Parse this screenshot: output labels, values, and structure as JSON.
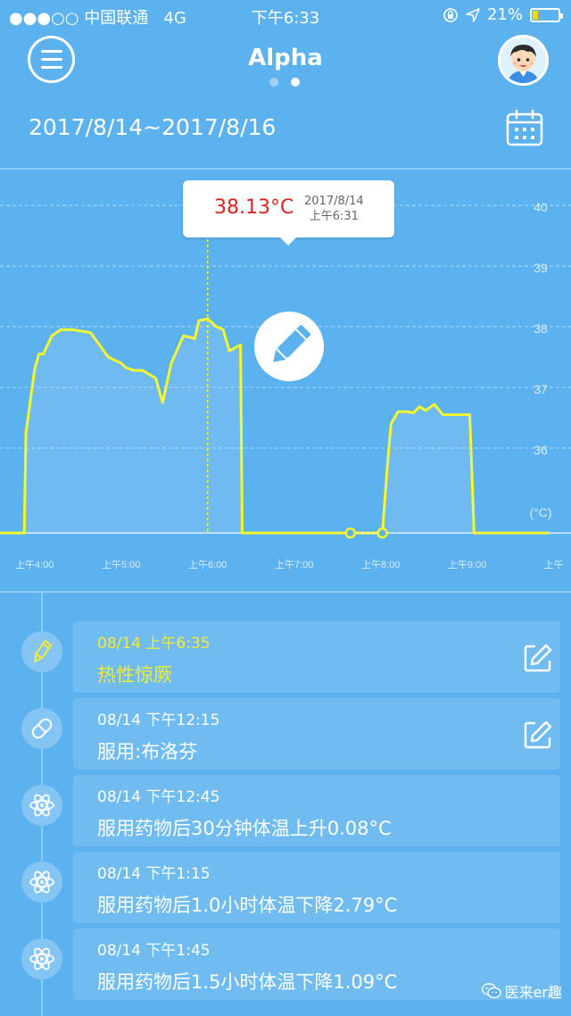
{
  "status_bar": {
    "signal": "●●●○○",
    "carrier": "中国联通",
    "network": "4G",
    "time": "下午6:33",
    "battery": "21%",
    "battery_level": 0.21
  },
  "header": {
    "title": "Alpha",
    "pages": 2,
    "active_page": 2
  },
  "date_range": "2017/8/14~2017/8/16",
  "tooltip": {
    "temperature": "38.13°C",
    "date": "2017/8/14",
    "time": "上午6:31"
  },
  "chart_data": {
    "type": "line",
    "y_unit_label": "(°C)",
    "y_ticks": [
      "36",
      "37",
      "38",
      "39",
      "40"
    ],
    "x_ticks": [
      "上午4:00",
      "上午5:00",
      "上午6:00",
      "上午7:00",
      "上午8:00",
      "上午9:00",
      "上午"
    ],
    "ylim": [
      34.6,
      40.0
    ],
    "xlim": [
      3.6,
      10.2
    ],
    "line_color": "#f4f62f",
    "series": [
      {
        "x": [
          3.6,
          3.88,
          3.9,
          4.0,
          4.05,
          4.1,
          4.2,
          4.3,
          4.45,
          4.65,
          4.85,
          5.0,
          5.05,
          5.15,
          5.25,
          5.4,
          5.48,
          5.58,
          5.72,
          5.82,
          5.85,
          5.9,
          6.0,
          6.1,
          6.18,
          6.25,
          6.38,
          6.4,
          7.05,
          7.15,
          7.3,
          7.6,
          7.65,
          7.8,
          7.98,
          8.02,
          8.08,
          8.12,
          8.2,
          8.3,
          8.38,
          8.45,
          8.52,
          8.62,
          8.72,
          9.03,
          9.08,
          9.1,
          9.45,
          9.95
        ],
        "values": [
          34.6,
          34.6,
          36.25,
          37.3,
          37.55,
          37.55,
          37.85,
          37.95,
          37.95,
          37.9,
          37.5,
          37.4,
          37.33,
          37.28,
          37.28,
          37.15,
          36.75,
          37.4,
          37.85,
          37.82,
          37.8,
          38.1,
          38.13,
          38.0,
          37.95,
          37.6,
          37.7,
          34.6,
          34.6,
          34.6,
          34.6,
          34.6,
          34.6,
          34.6,
          34.6,
          34.6,
          35.75,
          36.4,
          36.6,
          36.6,
          36.58,
          36.68,
          36.62,
          36.72,
          36.55,
          36.55,
          34.6,
          34.6,
          34.6,
          34.6
        ]
      }
    ],
    "markers": [
      {
        "x": 7.65,
        "y": 34.6
      },
      {
        "x": 8.02,
        "y": 34.6
      }
    ],
    "selected": {
      "x": 6.0,
      "y": 38.13
    },
    "grid": true
  },
  "events": [
    {
      "time": "08/14 上午6:35",
      "description": "热性惊厥",
      "icon": "pencil-icon",
      "editable": true,
      "highlight": true
    },
    {
      "time": "08/14 下午12:15",
      "description": "服用:布洛芬",
      "icon": "pill-icon",
      "editable": true,
      "highlight": false
    },
    {
      "time": "08/14 下午12:45",
      "description": "服用药物后30分钟体温上升0.08°C",
      "icon": "atom-icon",
      "editable": false,
      "highlight": false
    },
    {
      "time": "08/14 下午1:15",
      "description": "服用药物后1.0小时体温下降2.79°C",
      "icon": "atom-icon",
      "editable": false,
      "highlight": false
    },
    {
      "time": "08/14 下午1:45",
      "description": "服用药物后1.5小时体温下降1.09°C",
      "icon": "atom-icon",
      "editable": false,
      "highlight": false
    }
  ],
  "watermark": "医来er趣"
}
